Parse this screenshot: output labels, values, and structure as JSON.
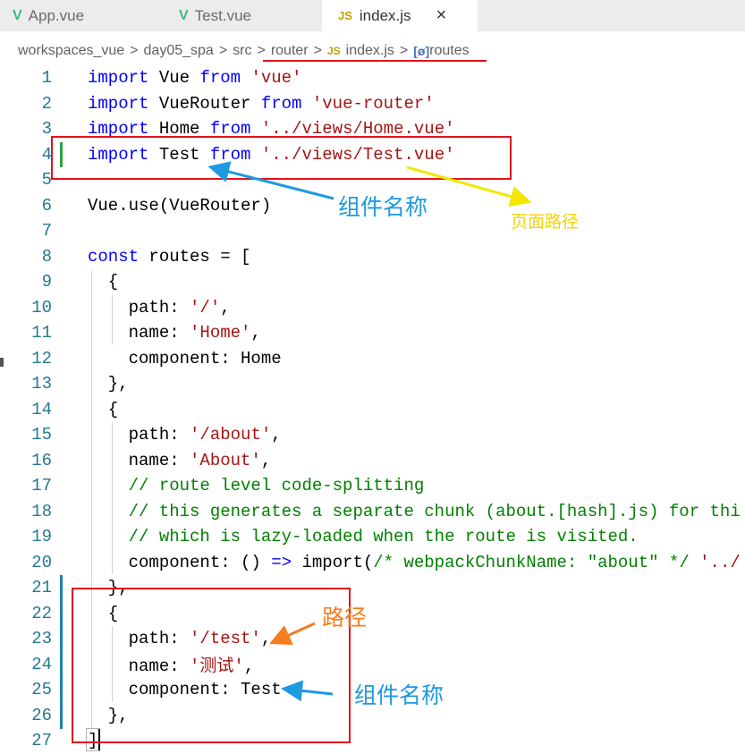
{
  "tabs": [
    {
      "label": "App.vue",
      "icon": "vue-icon"
    },
    {
      "label": "Test.vue",
      "icon": "vue-icon"
    },
    {
      "label": "index.js",
      "icon": "js-icon",
      "active": true
    }
  ],
  "tab_close": "×",
  "breadcrumb": [
    "workspaces_vue",
    "day05_spa",
    "src",
    "router",
    "index.js",
    "routes"
  ],
  "breadcrumb_js": "JS",
  "tab_js": "JS",
  "symbol_icon": "[ø]",
  "code_lines": [
    {
      "n": "1"
    },
    {
      "n": "2"
    },
    {
      "n": "3"
    },
    {
      "n": "4"
    },
    {
      "n": "5"
    },
    {
      "n": "6"
    },
    {
      "n": "7"
    },
    {
      "n": "8"
    },
    {
      "n": "9"
    },
    {
      "n": "10"
    },
    {
      "n": "11"
    },
    {
      "n": "12"
    },
    {
      "n": "13"
    },
    {
      "n": "14"
    },
    {
      "n": "15"
    },
    {
      "n": "16"
    },
    {
      "n": "17"
    },
    {
      "n": "18"
    },
    {
      "n": "19"
    },
    {
      "n": "20"
    },
    {
      "n": "21"
    },
    {
      "n": "22"
    },
    {
      "n": "23"
    },
    {
      "n": "24"
    },
    {
      "n": "25"
    },
    {
      "n": "26"
    },
    {
      "n": "27"
    }
  ],
  "code": {
    "l1": [
      "import",
      " Vue ",
      "from",
      " ",
      "'vue'"
    ],
    "l2": [
      "import",
      " VueRouter ",
      "from",
      " ",
      "'vue-router'"
    ],
    "l3": [
      "import",
      " Home ",
      "from",
      " ",
      "'../views/Home.vue'"
    ],
    "l4": [
      "import",
      " Test ",
      "from",
      " ",
      "'../views/Test.vue'"
    ],
    "l6": "Vue.use(VueRouter)",
    "l8": [
      "const",
      " routes = ["
    ],
    "l9": "  {",
    "l10": [
      "    path: ",
      "'/'",
      ","
    ],
    "l11": [
      "    name: ",
      "'Home'",
      ","
    ],
    "l12": "    component: Home",
    "l13": "  },",
    "l14": "  {",
    "l15": [
      "    path: ",
      "'/about'",
      ","
    ],
    "l16": [
      "    name: ",
      "'About'",
      ","
    ],
    "l17": "    // route level code-splitting",
    "l18": "    // this generates a separate chunk (about.[hash].js) for thi",
    "l19": "    // which is lazy-loaded when the route is visited.",
    "l20": [
      "    component: () ",
      "=>",
      " import(",
      "/* webpackChunkName: \"about\" */",
      " '../"
    ],
    "l21": "  },",
    "l22": "  {",
    "l23": [
      "    path: ",
      "'/test'",
      ","
    ],
    "l24": [
      "    name: ",
      "'测试'",
      ","
    ],
    "l25": "    component: Test",
    "l26": "  },",
    "l27": "]"
  },
  "annotations": {
    "component_name_top": "组件名称",
    "page_path": "页面路径",
    "path": "路径",
    "component_name_bottom": "组件名称"
  },
  "colors": {
    "red": "#e3101b",
    "blue_arrow": "#1e9ae0",
    "yellow_arrow": "#f5e600",
    "orange_arrow": "#f57c1f"
  }
}
